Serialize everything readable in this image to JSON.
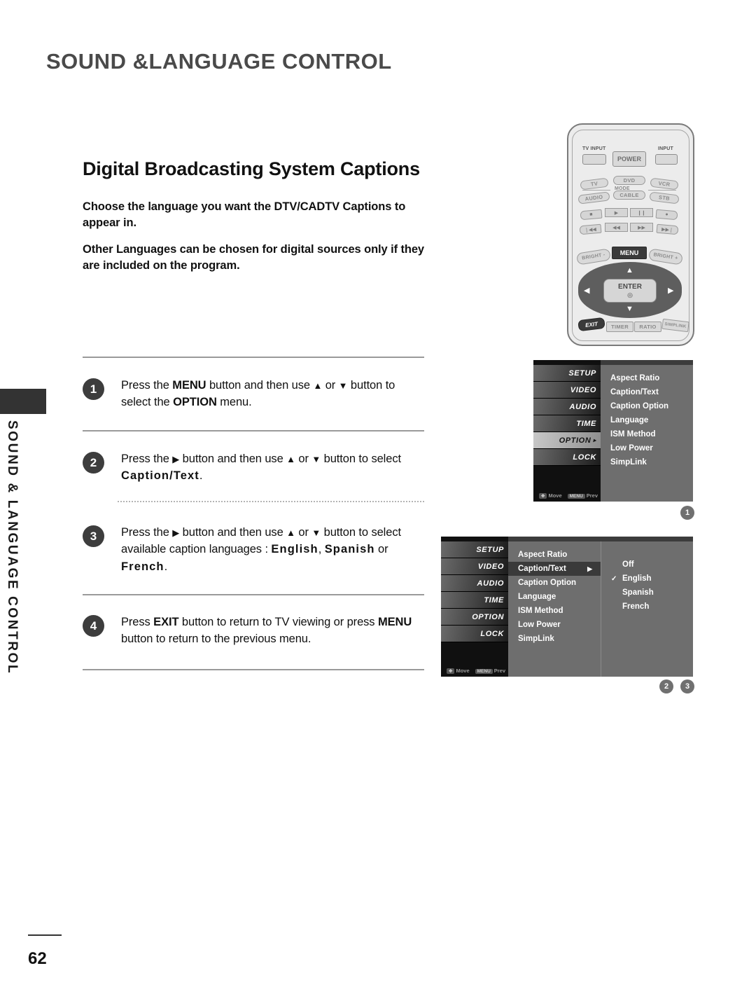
{
  "header": {
    "title": "SOUND &LANGUAGE CONTROL"
  },
  "side_tab": {
    "label": "SOUND & LANGUAGE CONTROL"
  },
  "section": {
    "title": "Digital Broadcasting System Captions",
    "paragraphs": [
      "Choose the language you want the DTV/CADTV Captions to appear in.",
      "Other Languages can be chosen for digital sources only if they are included on the program."
    ]
  },
  "steps": [
    {
      "number": "1",
      "parts": [
        {
          "t": "Press the ",
          "style": "normal"
        },
        {
          "t": "MENU",
          "style": "bold"
        },
        {
          "t": " button and then use ",
          "style": "normal"
        },
        {
          "t": "▲",
          "style": "arrow"
        },
        {
          "t": " or ",
          "style": "normal"
        },
        {
          "t": "▼",
          "style": "arrow"
        },
        {
          "t": " button to select the ",
          "style": "normal"
        },
        {
          "t": "OPTION",
          "style": "bold"
        },
        {
          "t": " menu.",
          "style": "normal"
        }
      ]
    },
    {
      "number": "2",
      "parts": [
        {
          "t": "Press the ",
          "style": "normal"
        },
        {
          "t": "▶",
          "style": "arrow"
        },
        {
          "t": " button and then use ",
          "style": "normal"
        },
        {
          "t": "▲",
          "style": "arrow"
        },
        {
          "t": " or ",
          "style": "normal"
        },
        {
          "t": "▼",
          "style": "arrow"
        },
        {
          "t": " button to select ",
          "style": "normal"
        },
        {
          "t": "Caption/Text",
          "style": "spaced"
        },
        {
          "t": ".",
          "style": "normal"
        }
      ]
    },
    {
      "number": "3",
      "parts": [
        {
          "t": "Press the ",
          "style": "normal"
        },
        {
          "t": "▶",
          "style": "arrow"
        },
        {
          "t": " button and then use ",
          "style": "normal"
        },
        {
          "t": "▲",
          "style": "arrow"
        },
        {
          "t": " or ",
          "style": "normal"
        },
        {
          "t": "▼",
          "style": "arrow"
        },
        {
          "t": " button to select available caption languages : ",
          "style": "normal"
        },
        {
          "t": "English",
          "style": "spaced"
        },
        {
          "t": ", ",
          "style": "normal"
        },
        {
          "t": "Spanish",
          "style": "spaced"
        },
        {
          "t": " or ",
          "style": "normal"
        },
        {
          "t": "French",
          "style": "spaced"
        },
        {
          "t": ".",
          "style": "normal"
        }
      ]
    },
    {
      "number": "4",
      "parts": [
        {
          "t": "Press ",
          "style": "normal"
        },
        {
          "t": "EXIT",
          "style": "bold"
        },
        {
          "t": " button to return to TV viewing or press ",
          "style": "normal"
        },
        {
          "t": "MENU",
          "style": "bold"
        },
        {
          "t": " button to return to the previous menu.",
          "style": "normal"
        }
      ]
    }
  ],
  "remote": {
    "tv_input_label": "TV INPUT",
    "input_label": "INPUT",
    "power_label": "POWER",
    "mode_label": "MODE",
    "mode_row1": [
      "TV",
      "DVD",
      "VCR"
    ],
    "mode_row2": [
      "AUDIO",
      "CABLE",
      "STB"
    ],
    "media_row1": [
      "■",
      "▶",
      "❙❙",
      "●"
    ],
    "media_row2": [
      "❘◀◀",
      "◀◀",
      "▶▶",
      "▶▶❘"
    ],
    "bright_minus": "BRIGHT -",
    "bright_plus": "BRIGHT +",
    "menu_label": "MENU",
    "enter_label": "ENTER",
    "enter_glyph": "◎",
    "up_glyph": "▲",
    "down_glyph": "▼",
    "left_glyph": "◀",
    "right_glyph": "▶",
    "exit_label": "EXIT",
    "bottom_row": [
      "TIMER",
      "RATIO",
      "SIMPLINK"
    ]
  },
  "osd1": {
    "categories": [
      {
        "label": "SETUP",
        "active": false
      },
      {
        "label": "VIDEO",
        "active": false
      },
      {
        "label": "AUDIO",
        "active": false
      },
      {
        "label": "TIME",
        "active": false
      },
      {
        "label": "OPTION",
        "active": true
      },
      {
        "label": "LOCK",
        "active": false
      }
    ],
    "items": [
      "Aspect Ratio",
      "Caption/Text",
      "Caption Option",
      "Language",
      "ISM Method",
      "Low Power",
      "SimpLink"
    ],
    "footer": {
      "move": "Move",
      "move_key": "✥",
      "prev": "Prev",
      "prev_key": "MENU"
    },
    "callouts": [
      "1"
    ]
  },
  "osd2": {
    "categories": [
      {
        "label": "SETUP",
        "active": false
      },
      {
        "label": "VIDEO",
        "active": false
      },
      {
        "label": "AUDIO",
        "active": false
      },
      {
        "label": "TIME",
        "active": false
      },
      {
        "label": "OPTION",
        "active": false
      },
      {
        "label": "LOCK",
        "active": false
      }
    ],
    "items": [
      {
        "label": "Aspect Ratio",
        "selected": false,
        "arrow": ""
      },
      {
        "label": "Caption/Text",
        "selected": true,
        "arrow": "▶"
      },
      {
        "label": "Caption Option",
        "selected": false,
        "arrow": ""
      },
      {
        "label": "Language",
        "selected": false,
        "arrow": ""
      },
      {
        "label": "ISM Method",
        "selected": false,
        "arrow": ""
      },
      {
        "label": "Low Power",
        "selected": false,
        "arrow": ""
      },
      {
        "label": "SimpLink",
        "selected": false,
        "arrow": ""
      }
    ],
    "submenu": [
      {
        "label": "Off",
        "checked": false
      },
      {
        "label": "English",
        "checked": true
      },
      {
        "label": "Spanish",
        "checked": false
      },
      {
        "label": "French",
        "checked": false
      }
    ],
    "check_glyph": "✓",
    "footer": {
      "move": "Move",
      "move_key": "✥",
      "prev": "Prev",
      "prev_key": "MENU"
    },
    "callouts": [
      "2",
      "3"
    ]
  },
  "footer": {
    "page_number": "62"
  },
  "colors": {
    "header_text": "#4a4a4a",
    "osd_panel": "#6e6e6e",
    "osd_selected": "#3a3a3a",
    "badge": "#3d3d3d",
    "callout": "#707070"
  }
}
